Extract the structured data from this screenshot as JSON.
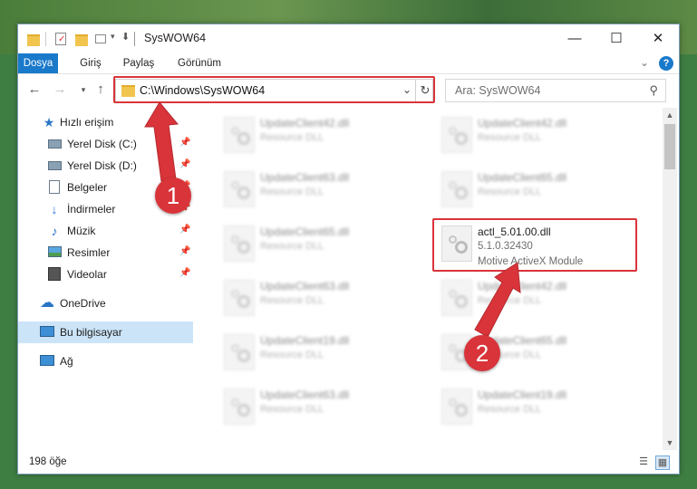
{
  "window": {
    "title": "SysWOW64"
  },
  "ribbon": {
    "tabs": [
      "Dosya",
      "Giriş",
      "Paylaş",
      "Görünüm"
    ],
    "help": "?"
  },
  "address": {
    "path": "C:\\Windows\\SysWOW64",
    "search_placeholder": "Ara: SysWOW64"
  },
  "sidebar": {
    "items": [
      {
        "label": "Hızlı erişim",
        "icon": "star-icon",
        "pinned": false
      },
      {
        "label": "Yerel Disk (C:)",
        "icon": "drive-icon",
        "pinned": true
      },
      {
        "label": "Yerel Disk (D:)",
        "icon": "drive-icon",
        "pinned": true
      },
      {
        "label": "Belgeler",
        "icon": "document-icon",
        "pinned": true
      },
      {
        "label": "İndirmeler",
        "icon": "download-icon",
        "pinned": true
      },
      {
        "label": "Müzik",
        "icon": "music-icon",
        "pinned": true
      },
      {
        "label": "Resimler",
        "icon": "picture-icon",
        "pinned": true
      },
      {
        "label": "Videolar",
        "icon": "video-icon",
        "pinned": true
      },
      {
        "label": "OneDrive",
        "icon": "cloud-icon",
        "pinned": false
      },
      {
        "label": "Bu bilgisayar",
        "icon": "computer-icon",
        "pinned": false,
        "selected": true
      },
      {
        "label": "Ağ",
        "icon": "network-icon",
        "pinned": false
      }
    ]
  },
  "files": {
    "left_column": [
      {
        "name": "UpdateClient42.dll",
        "type": "Resource DLL"
      },
      {
        "name": "UpdateClient63.dll",
        "type": "Resource DLL"
      },
      {
        "name": "UpdateClient65.dll",
        "type": "Resource DLL"
      },
      {
        "name": "UpdateClient63.dll",
        "type": "Resource DLL"
      },
      {
        "name": "UpdateClient19.dll",
        "type": "Resource DLL"
      },
      {
        "name": "UpdateClient63.dll",
        "type": "Resource DLL"
      }
    ],
    "right_column": [
      {
        "name": "UpdateClient42.dll",
        "type": "Resource DLL"
      },
      {
        "name": "UpdateClient65.dll",
        "type": "Resource DLL"
      },
      {
        "name": "UpdateClient42.dll",
        "type": "Resource DLL"
      },
      {
        "name": "UpdateClient65.dll",
        "type": "Resource DLL"
      },
      {
        "name": "UpdateClient19.dll",
        "type": "Resource DLL"
      }
    ],
    "highlighted": {
      "name": "actl_5.01.00.dll",
      "version": "5.1.0.32430",
      "description": "Motive ActiveX Module"
    }
  },
  "status": {
    "count": "198 öğe"
  },
  "annotations": {
    "step1": "1",
    "step2": "2",
    "color": "#d9343a"
  }
}
